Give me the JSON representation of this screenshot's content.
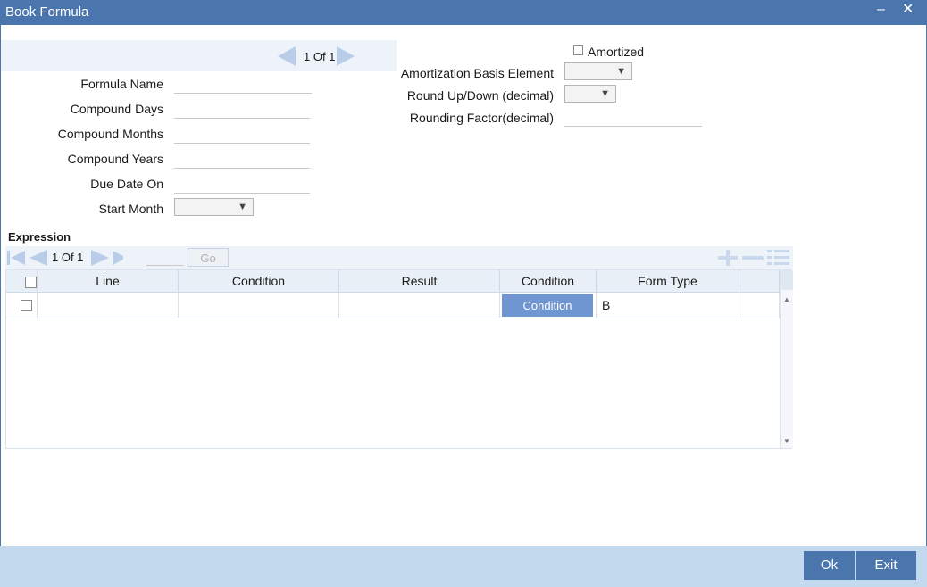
{
  "window": {
    "title": "Book Formula",
    "minimize_glyph": "‒",
    "close_glyph": "✕"
  },
  "top_pager": {
    "text": "1 Of 1"
  },
  "form": {
    "formula_name_label": "Formula Name",
    "compound_days_label": "Compound Days",
    "compound_months_label": "Compound Months",
    "compound_years_label": "Compound Years",
    "due_date_on_label": "Due Date On",
    "start_month_label": "Start Month",
    "amortized_label": "Amortized",
    "amortization_basis_label": "Amortization Basis Element",
    "round_updown_label": "Round Up/Down (decimal)",
    "rounding_factor_label": "Rounding Factor(decimal)"
  },
  "expression": {
    "title": "Expression",
    "pager_text": "1 Of 1",
    "go_label": "Go",
    "columns": [
      "Line",
      "Condition",
      "Result",
      "Condition",
      "Form Type"
    ],
    "rows": [
      {
        "line": "",
        "condition": "",
        "result": "",
        "condition_button": "Condition",
        "form_type": "B"
      }
    ]
  },
  "footer": {
    "ok_label": "Ok",
    "exit_label": "Exit"
  },
  "colors": {
    "titlebar": "#4a75ad",
    "footer": "#c3d9ee",
    "accent_button": "#6f96d1"
  }
}
